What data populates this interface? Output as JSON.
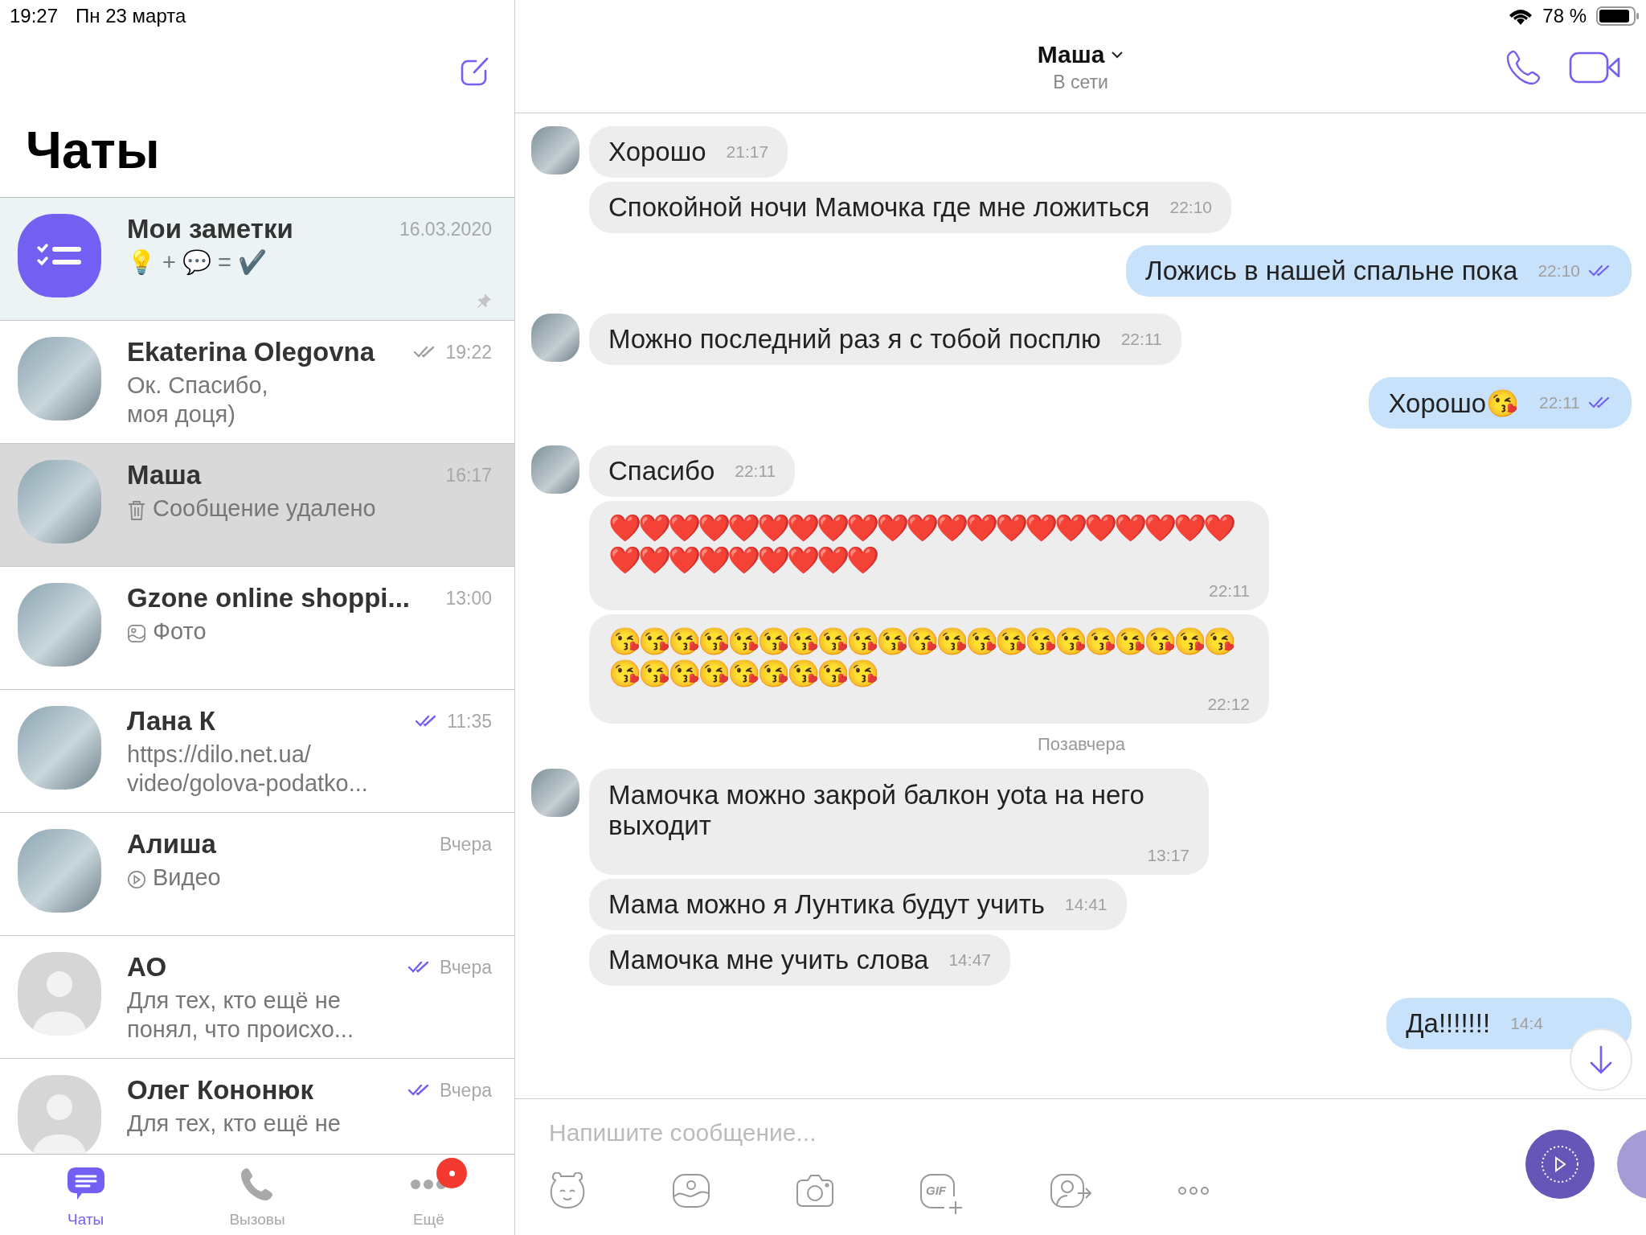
{
  "status_bar": {
    "time": "19:27",
    "date": "Пн 23 марта",
    "battery": "78 %"
  },
  "sidebar": {
    "title": "Чаты",
    "chats": [
      {
        "name": "Мои заметки",
        "avatar": {
          "kind": "notes"
        },
        "time": "16.03.2020",
        "preview": {
          "kind": "text",
          "lines": [
            "💡 + 💬 = ✔️"
          ]
        },
        "pinned": true,
        "selected": false
      },
      {
        "name": "Ekaterina Olegovna",
        "avatar": {
          "kind": "photo"
        },
        "time": "19:22",
        "delivered": true,
        "read": false,
        "preview": {
          "kind": "text",
          "lines": [
            "Ок. Спасибо,",
            "моя доця)"
          ]
        },
        "pinned": false,
        "selected": false
      },
      {
        "name": "Маша",
        "avatar": {
          "kind": "photo"
        },
        "time": "16:17",
        "preview": {
          "kind": "deleted",
          "lines": [
            "Сообщение удалено"
          ]
        },
        "pinned": false,
        "selected": true
      },
      {
        "name": "Gzone online shoppi...",
        "avatar": {
          "kind": "photo"
        },
        "time": "13:00",
        "preview": {
          "kind": "photo",
          "lines": [
            "Фото"
          ]
        },
        "pinned": false,
        "selected": false
      },
      {
        "name": "Лана К",
        "avatar": {
          "kind": "photo"
        },
        "time": "11:35",
        "delivered": true,
        "read": true,
        "preview": {
          "kind": "text",
          "lines": [
            "https://dilo.net.ua/",
            "video/golova-podatko..."
          ]
        },
        "pinned": false,
        "selected": false
      },
      {
        "name": "Алиша",
        "avatar": {
          "kind": "photo"
        },
        "time": "Вчера",
        "preview": {
          "kind": "video",
          "lines": [
            "Видео"
          ]
        },
        "pinned": false,
        "selected": false
      },
      {
        "name": "АО",
        "avatar": {
          "kind": "default"
        },
        "time": "Вчера",
        "delivered": true,
        "read": true,
        "preview": {
          "kind": "text",
          "lines": [
            "Для тех, кто ещё не",
            "понял, что происхо..."
          ]
        },
        "pinned": false,
        "selected": false
      },
      {
        "name": "Олег Кононюк",
        "avatar": {
          "kind": "default"
        },
        "time": "Вчера",
        "delivered": true,
        "read": true,
        "preview": {
          "kind": "text",
          "lines": [
            "Для тех, кто ещё не"
          ]
        },
        "pinned": false,
        "selected": false
      }
    ]
  },
  "tab_bar": [
    {
      "label": "Чаты",
      "selected": true,
      "badge": false
    },
    {
      "label": "Вызовы",
      "selected": false,
      "badge": false
    },
    {
      "label": "Ещё",
      "selected": false,
      "badge": true
    }
  ],
  "conversation": {
    "title": "Маша",
    "subtitle": "В сети",
    "messages": [
      {
        "kind": "text",
        "outgoing": false,
        "avatar": true,
        "text": "Хорошо",
        "time": "21:17"
      },
      {
        "kind": "text",
        "outgoing": false,
        "avatar": false,
        "text": "Спокойной ночи Мамочка где мне ложиться",
        "time": "22:10"
      },
      {
        "kind": "text",
        "outgoing": true,
        "text": "Ложись в нашей спальне пока",
        "time": "22:10",
        "read": true
      },
      {
        "kind": "text",
        "outgoing": false,
        "avatar": true,
        "text": "Можно последний раз я с тобой посплю",
        "time": "22:11"
      },
      {
        "kind": "text",
        "outgoing": true,
        "text": "Хорошо😘",
        "time": "22:11",
        "read": true
      },
      {
        "kind": "text",
        "outgoing": false,
        "avatar": true,
        "text": "Спасибо",
        "time": "22:11"
      },
      {
        "kind": "emoji",
        "outgoing": false,
        "avatar": false,
        "text": "❤️❤️❤️❤️❤️❤️❤️❤️❤️❤️❤️❤️❤️❤️❤️❤️❤️❤️❤️❤️❤️❤️❤️❤️❤️❤️❤️❤️❤️❤️",
        "time": "22:11"
      },
      {
        "kind": "emoji",
        "outgoing": false,
        "avatar": false,
        "text": "😘😘😘😘😘😘😘😘😘😘😘😘😘😘😘😘😘😘😘😘😘😘😘😘😘😘😘😘😘😘",
        "time": "22:12"
      },
      {
        "kind": "date",
        "text": "Позавчера"
      },
      {
        "kind": "block",
        "outgoing": false,
        "avatar": true,
        "text": "Мамочка можно закрой балкон yota на него выходит",
        "time": "13:17"
      },
      {
        "kind": "text",
        "outgoing": false,
        "avatar": false,
        "text": "Мама можно я Лунтика будут учить",
        "time": "14:41"
      },
      {
        "kind": "text",
        "outgoing": false,
        "avatar": false,
        "text": "Мамочка мне учить слова",
        "time": "14:47"
      },
      {
        "kind": "text",
        "outgoing": true,
        "text": "Да!!!!!!!",
        "time": "14:4"
      }
    ]
  },
  "composer": {
    "placeholder": "Напишите сообщение...",
    "gif_label": "GIF"
  }
}
